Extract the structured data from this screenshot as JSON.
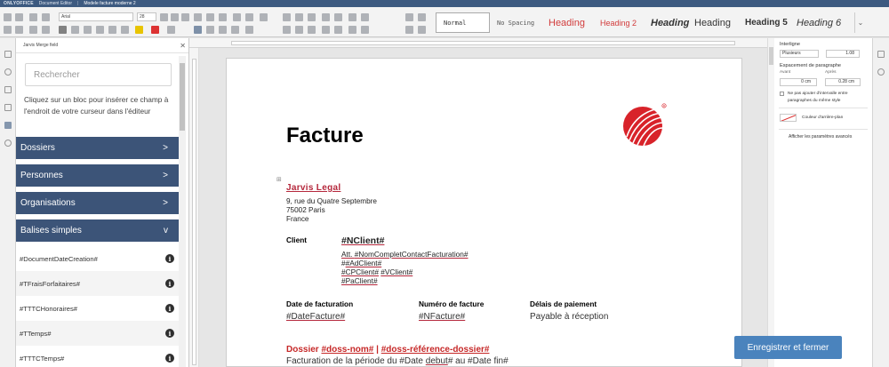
{
  "titlebar": {
    "brand": "ONLYOFFICE",
    "app": "Document Editor",
    "document": "Modele facture moderne 2"
  },
  "toolbar": {
    "font_name": "Arial",
    "font_size": "28",
    "styles": [
      {
        "label": "Normal",
        "cls": "normal"
      },
      {
        "label": "No Spacing",
        "cls": "nospacing"
      },
      {
        "label": "Heading",
        "cls": "h1"
      },
      {
        "label": "Heading 2",
        "cls": "h2"
      },
      {
        "label": "Heading",
        "cls": "h3"
      },
      {
        "label": "Heading",
        "cls": "h4"
      },
      {
        "label": "Heading 5",
        "cls": "h5"
      },
      {
        "label": "Heading 6",
        "cls": "h6"
      }
    ]
  },
  "panel": {
    "title": "Jarvis Merge field",
    "search_placeholder": "Rechercher",
    "hint": "Cliquez sur un bloc pour insérer ce champ à l'endroit de votre curseur dans l'éditeur",
    "categories": [
      {
        "label": "Dossiers",
        "chevron": ">"
      },
      {
        "label": "Personnes",
        "chevron": ">"
      },
      {
        "label": "Organisations",
        "chevron": ">"
      },
      {
        "label": "Balises simples",
        "chevron": "v"
      }
    ],
    "fields": [
      "#DocumentDateCreation#",
      "#TFraisForfaitaires#",
      "#TTTCHonoraires#",
      "#TTemps#",
      "#TTTCTemps#"
    ]
  },
  "document": {
    "title": "Facture",
    "company": "Jarvis Legal",
    "address": [
      "9, rue du Quatre Septembre",
      "75002 Paris",
      "France"
    ],
    "client_label": "Client",
    "client_code": "#NClient#",
    "client_lines": {
      "att_prefix": "Att. ",
      "att_field": "#NomCompletContactFacturation#",
      "adresse": "#AdClient#",
      "cp": "#CPClient#",
      "ville": "#VClient#",
      "pays": "#PaClient#"
    },
    "date_label": "Date de facturation",
    "date_value": "#DateFacture#",
    "numero_label": "Numéro de facture",
    "numero_value": "#NFacture#",
    "delais_label": "Délais de paiement",
    "delais_value": "Payable à réception",
    "dossier": {
      "prefix": "Dossier ",
      "num": "#doss-nom#",
      "sep": " | ",
      "ref": "#doss-référence-dossier#"
    },
    "periode": {
      "text1": "Facturation de la période du #Date ",
      "link": "debut",
      "text2": "# au #Date fin#"
    }
  },
  "settings": {
    "interligne_label": "Interligne",
    "interligne_mode": "Plusieurs",
    "interligne_value": "1.08",
    "espacement_label": "Espacement de paragraphe",
    "avant_label": "Avant",
    "apres_label": "Après",
    "avant_value": "0 cm",
    "apres_value": "0.28 cm",
    "no_interval": "Ne pas ajouter d'intervalle entre paragraphes du même style",
    "shade_label": "Couleur d'arrière-plan",
    "advanced_link": "Afficher les paramètres avancés"
  },
  "save_button": "Enregistrer et fermer",
  "colors": {
    "navy": "#3c5478",
    "accent_red": "#c62828",
    "button_blue": "#4a83bd"
  }
}
